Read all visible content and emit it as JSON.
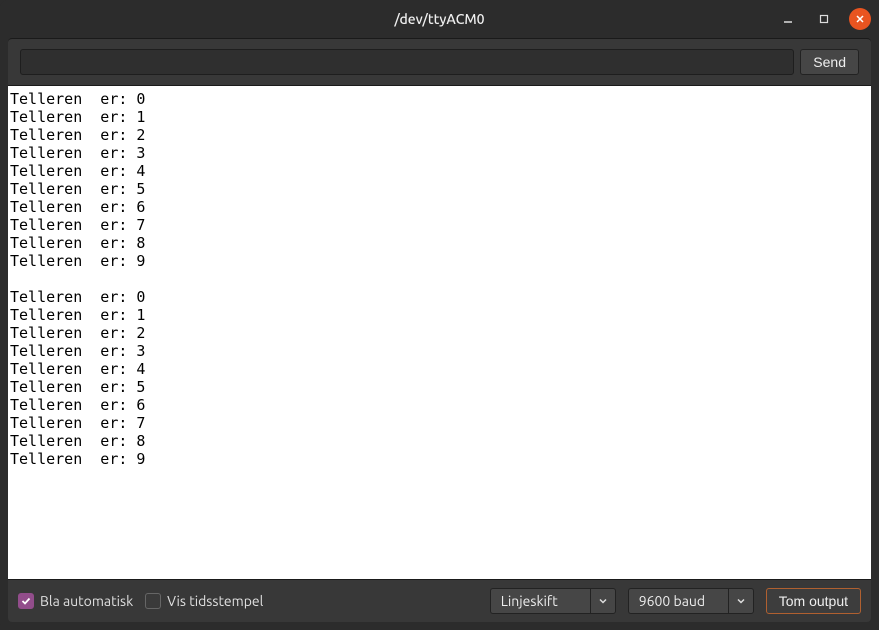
{
  "window": {
    "title": "/dev/ttyACM0"
  },
  "toolbar": {
    "input_value": "",
    "send_label": "Send"
  },
  "output": {
    "lines": [
      "Telleren  er: 0",
      "Telleren  er: 1",
      "Telleren  er: 2",
      "Telleren  er: 3",
      "Telleren  er: 4",
      "Telleren  er: 5",
      "Telleren  er: 6",
      "Telleren  er: 7",
      "Telleren  er: 8",
      "Telleren  er: 9",
      "",
      "Telleren  er: 0",
      "Telleren  er: 1",
      "Telleren  er: 2",
      "Telleren  er: 3",
      "Telleren  er: 4",
      "Telleren  er: 5",
      "Telleren  er: 6",
      "Telleren  er: 7",
      "Telleren  er: 8",
      "Telleren  er: 9"
    ]
  },
  "statusbar": {
    "autoscroll": {
      "label": "Bla automatisk",
      "checked": true
    },
    "timestamp": {
      "label": "Vis tidsstempel",
      "checked": false
    },
    "line_ending": {
      "selected": "Linjeskift"
    },
    "baud": {
      "selected": "9600 baud"
    },
    "clear_label": "Tom output"
  }
}
